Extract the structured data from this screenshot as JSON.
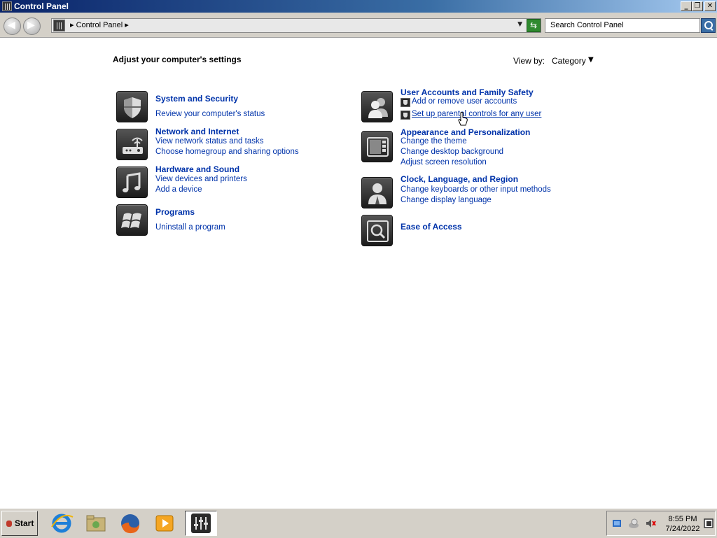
{
  "window": {
    "title": "Control Panel"
  },
  "address": {
    "breadcrumb": "Control Panel",
    "search_placeholder": "Search Control Panel"
  },
  "content": {
    "heading": "Adjust your computer's settings",
    "view_by_label": "View by:",
    "view_by_value": "Category"
  },
  "categories_left": [
    {
      "title": "System and Security",
      "links": [
        "Review your computer's status"
      ]
    },
    {
      "title": "Network and Internet",
      "links": [
        "View network status and tasks",
        "Choose homegroup and sharing options"
      ]
    },
    {
      "title": "Hardware and Sound",
      "links": [
        "View devices and printers",
        "Add a device"
      ]
    },
    {
      "title": "Programs",
      "links": [
        "Uninstall a program"
      ]
    }
  ],
  "categories_right": [
    {
      "title": "User Accounts and Family Safety",
      "links": [
        "Add or remove user accounts",
        "Set up parental controls for any user"
      ]
    },
    {
      "title": "Appearance and Personalization",
      "links": [
        "Change the theme",
        "Change desktop background",
        "Adjust screen resolution"
      ]
    },
    {
      "title": "Clock, Language, and Region",
      "links": [
        "Change keyboards or other input methods",
        "Change display language"
      ]
    },
    {
      "title": "Ease of Access",
      "links": []
    }
  ],
  "taskbar": {
    "start_label": "Start",
    "apps": [
      "internet-explorer-icon",
      "file-explorer-icon",
      "firefox-icon",
      "media-player-icon",
      "control-panel-icon"
    ],
    "time": "8:55 PM",
    "date": "7/24/2022"
  },
  "colors": {
    "link": "#0033aa",
    "titlebar_start": "#0a246a",
    "titlebar_end": "#a6caf0"
  }
}
